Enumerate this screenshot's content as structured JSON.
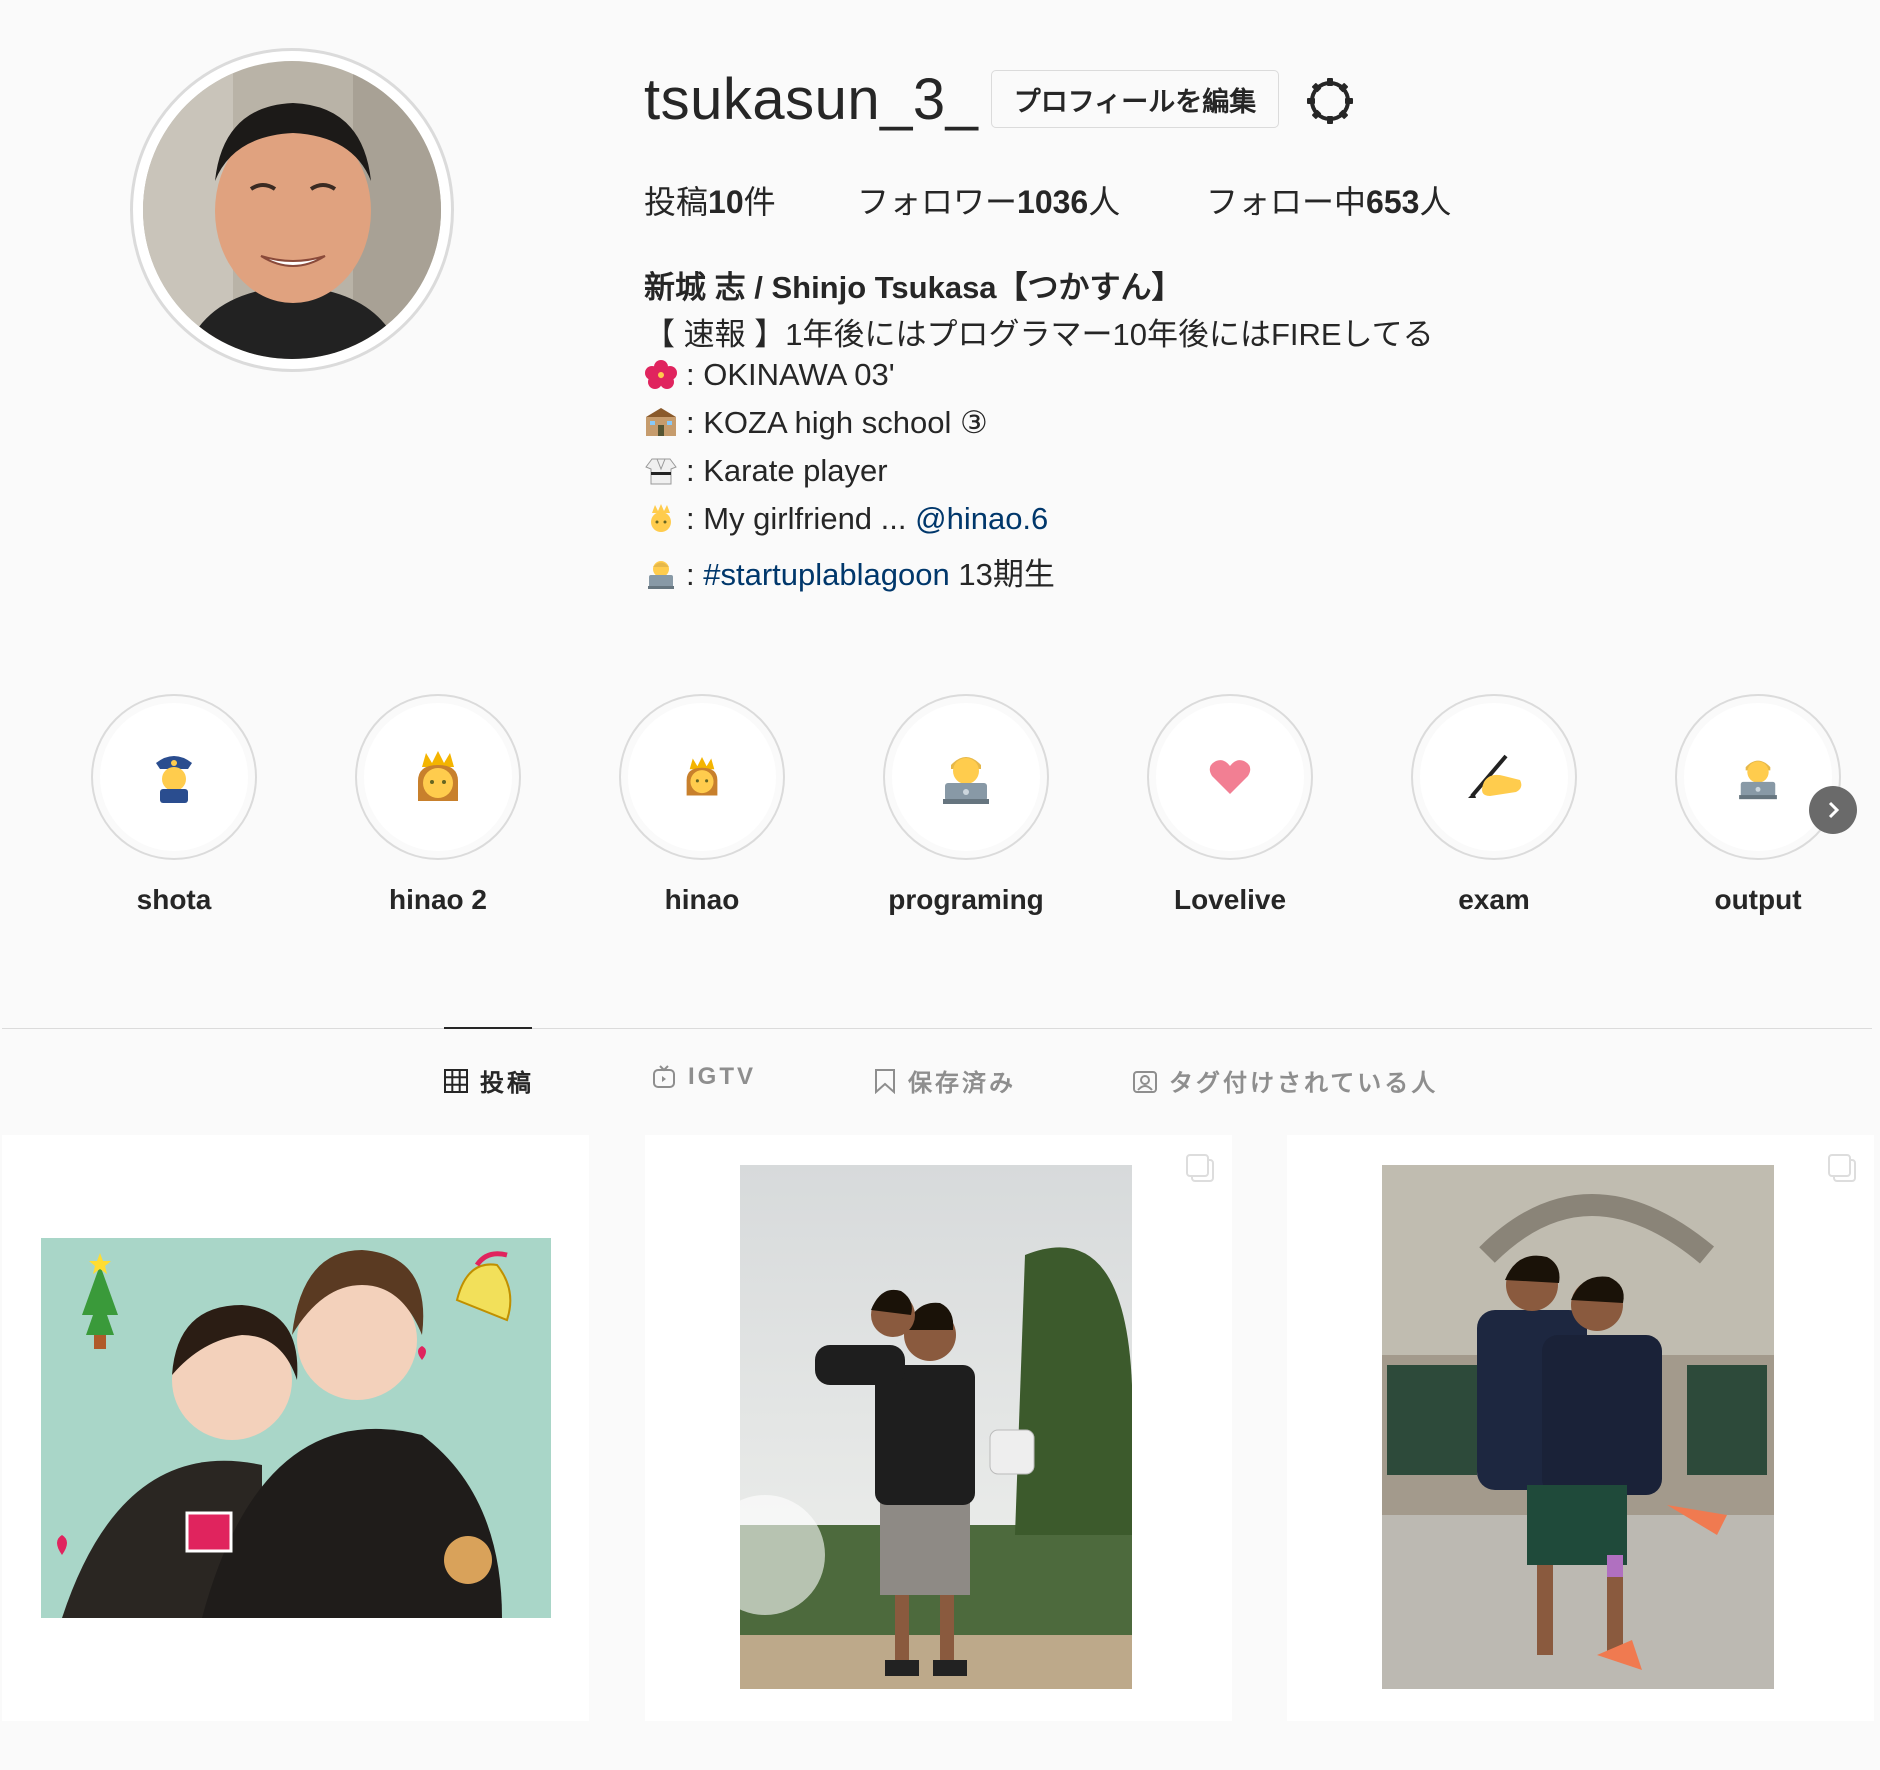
{
  "profile": {
    "username": "tsukasun_3_",
    "edit_button": "プロフィールを編集",
    "stats": {
      "posts_prefix": "投稿",
      "posts_count": "10",
      "posts_suffix": "件",
      "followers_prefix": "フォロワー",
      "followers_count": "1036",
      "followers_suffix": "人",
      "following_prefix": "フォロー中",
      "following_count": "653",
      "following_suffix": "人"
    },
    "full_name": "新城 志 / Shinjo Tsukasa【つかすん】",
    "bio": {
      "line1": "【 速報 】1年後にはプログラマー10年後にはFIREしてる",
      "line2": ": OKINAWA 03'",
      "line3": ": KOZA high school ③",
      "line4": ": Karate player",
      "line5_text": ": My girlfriend ... ",
      "line5_link": "@hinao.6",
      "line6_sep": ": ",
      "line6_link": "#startuplablagoon",
      "line6_text": " 13期生"
    }
  },
  "highlights": [
    {
      "label": "shota",
      "icon": "police-officer-icon"
    },
    {
      "label": "hinao 2",
      "icon": "princess-icon"
    },
    {
      "label": "hinao",
      "icon": "princess-icon"
    },
    {
      "label": "programing",
      "icon": "technologist-icon"
    },
    {
      "label": "Lovelive",
      "icon": "heart-icon"
    },
    {
      "label": "exam",
      "icon": "writing-hand-icon"
    },
    {
      "label": "output",
      "icon": "technologist-icon"
    }
  ],
  "tabs": {
    "posts": "投稿",
    "igtv": "IGTV",
    "saved": "保存済み",
    "tagged": "タグ付けされている人"
  },
  "colors": {
    "background": "#fafafa",
    "border": "#dbdbdb",
    "text": "#262626",
    "link": "#00376b"
  }
}
